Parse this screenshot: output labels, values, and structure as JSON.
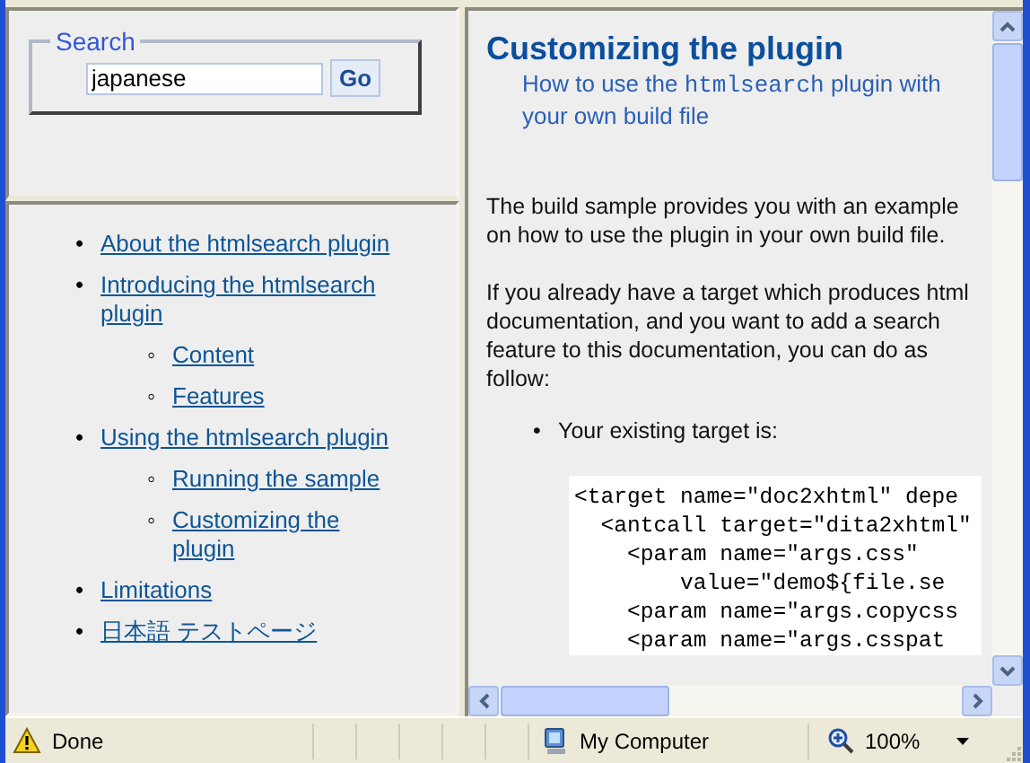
{
  "search": {
    "legend": "Search",
    "value": "japanese",
    "button": "Go"
  },
  "toc": [
    {
      "marker": "•",
      "label": "About the htmlsearch plugin"
    },
    {
      "marker": "•",
      "label": "Introducing the htmlsearch plugin",
      "children": [
        {
          "marker": "◦",
          "label": "Content"
        },
        {
          "marker": "◦",
          "label": "Features"
        }
      ]
    },
    {
      "marker": "•",
      "label": "Using the htmlsearch plugin",
      "children": [
        {
          "marker": "◦",
          "label": "Running the sample"
        },
        {
          "marker": "◦",
          "label": "Customizing the plugin"
        }
      ]
    },
    {
      "marker": "•",
      "label": "Limitations"
    },
    {
      "marker": "•",
      "label": "日本語 テストページ"
    }
  ],
  "article": {
    "title": "Customizing the plugin",
    "subtitle": [
      {
        "kind": "text",
        "text": "How to use the "
      },
      {
        "kind": "code",
        "text": "htmlsearch"
      },
      {
        "kind": "text",
        "text": " plugin with your own build file"
      }
    ],
    "paragraphs": [
      "The build sample provides you with an example on how to use the plugin in your own build file.",
      "If you already have a target which produces html documentation, and you want to add a search feature to this documentation, you can do as follow:"
    ],
    "bullets": [
      {
        "marker": "•",
        "text": "Your existing target is:"
      }
    ],
    "code_lines": [
      "<target name=\"doc2xhtml\" depe",
      "  <antcall target=\"dita2xhtml\"",
      "    <param name=\"args.css\"",
      "        value=\"demo${file.se",
      "    <param name=\"args.copycss",
      "    <param name=\"args.csspat"
    ]
  },
  "status_bar": {
    "text": "Done",
    "zone": "My Computer",
    "zoom": "100%"
  }
}
